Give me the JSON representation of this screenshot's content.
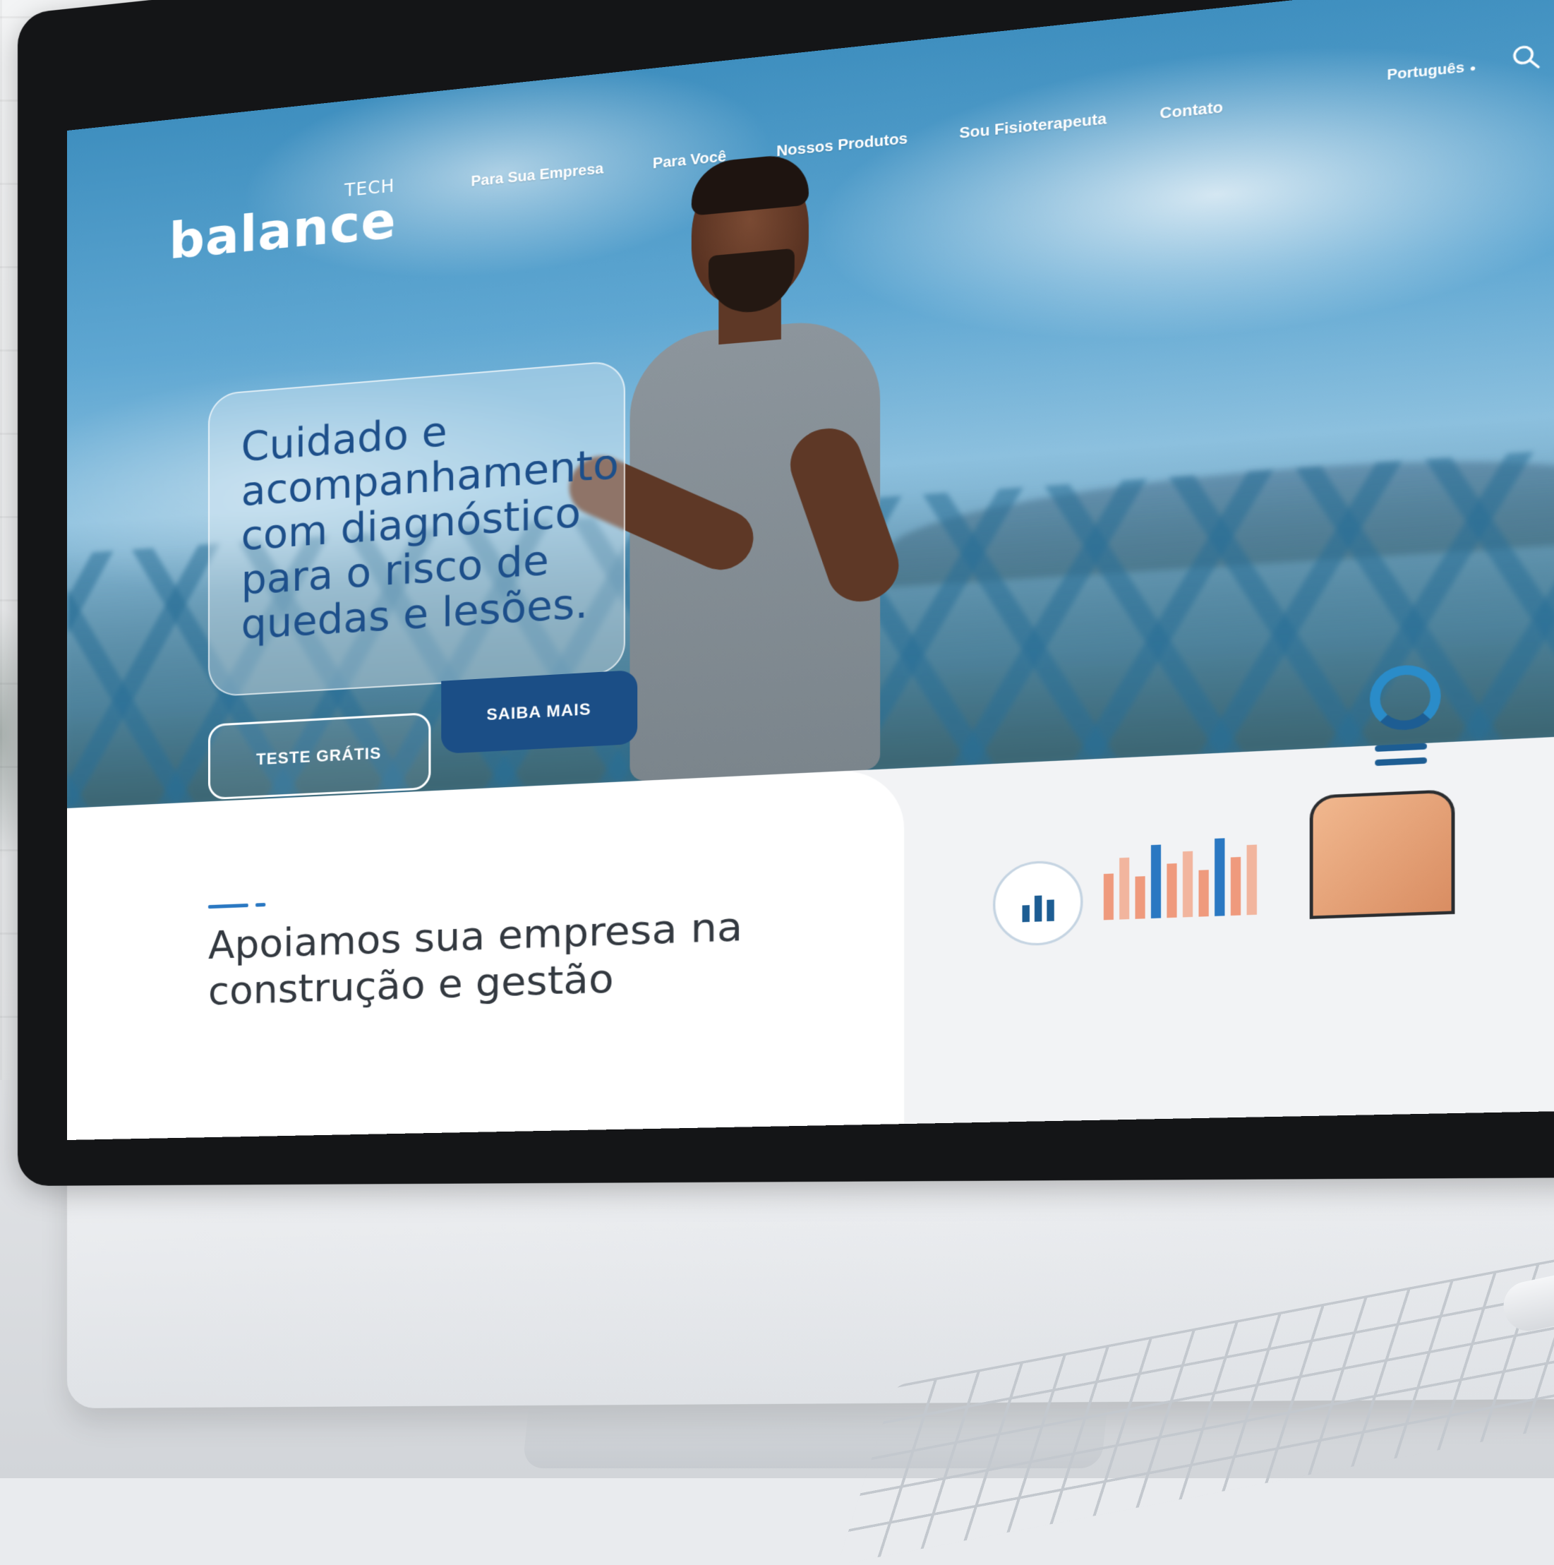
{
  "logo": {
    "word": "balance",
    "tech": "TECH"
  },
  "nav": {
    "items": [
      {
        "label": "Para Sua Empresa"
      },
      {
        "label": "Para Você"
      },
      {
        "label": "Nossos Produtos"
      },
      {
        "label": "Sou Fisioterapeuta"
      },
      {
        "label": "Contato"
      }
    ],
    "language": "Português"
  },
  "hero": {
    "title": "Cuidado e acompanhamento com diagnóstico para o risco de quedas e lesões.",
    "buttons": {
      "primary": "SAIBA MAIS",
      "secondary": "TESTE GRÁTIS"
    }
  },
  "section": {
    "title": "Apoiamos sua empresa na construção e gestão"
  },
  "colors": {
    "brand_blue": "#1b4e86",
    "accent_blue": "#2a78c2",
    "hero_title": "#1d4f8a"
  },
  "icons": [
    "search-icon",
    "chevron-down-icon",
    "ring-icon",
    "equals-icon",
    "bar-chart-icon"
  ]
}
